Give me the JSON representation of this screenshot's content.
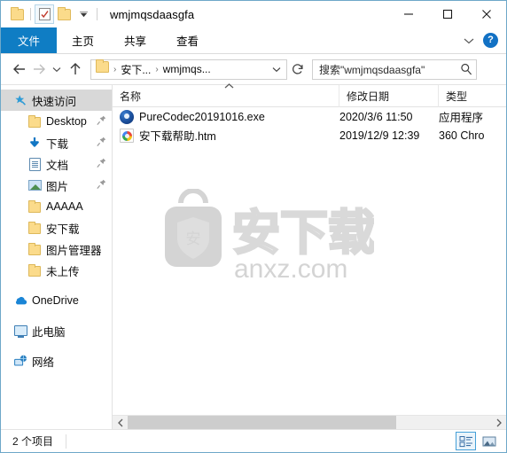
{
  "window": {
    "title": "wmjmqsdaasgfa",
    "quick_access_toolbar": [
      {
        "name": "folder-icon",
        "label": "属性"
      },
      {
        "name": "properties-icon",
        "label": "属性"
      },
      {
        "name": "new-folder-icon",
        "label": "新建文件夹"
      },
      {
        "name": "customize-dropdown-icon",
        "label": "自定义快速访问工具栏"
      }
    ],
    "caption": {
      "minimize": "—",
      "maximize": "□",
      "close": "✕"
    }
  },
  "ribbon": {
    "tabs": [
      {
        "label": "文件",
        "active": true
      },
      {
        "label": "主页",
        "active": false
      },
      {
        "label": "共享",
        "active": false
      },
      {
        "label": "查看",
        "active": false
      }
    ],
    "expand_icon": "chevron-down-icon",
    "help_label": "?"
  },
  "navigation": {
    "back_label": "←",
    "forward_label": "→",
    "recent_label": "⌄",
    "up_label": "↑",
    "breadcrumb": [
      {
        "label": "安下...",
        "sep": "›"
      },
      {
        "label": "wmjmqs...",
        "sep": ""
      }
    ],
    "dropdown_label": "⌄",
    "refresh_label": "↻"
  },
  "search": {
    "placeholder": "搜索\"wmjmqsdaasgfa\"",
    "icon": "search-icon"
  },
  "sidebar": {
    "groups": [
      {
        "items": [
          {
            "label": "快速访问",
            "icon": "star-pin-icon",
            "level": 0,
            "selected": true,
            "pinned": false
          },
          {
            "label": "Desktop",
            "icon": "folder-icon",
            "level": 1,
            "selected": false,
            "pinned": true
          },
          {
            "label": "下载",
            "icon": "download-icon",
            "level": 1,
            "selected": false,
            "pinned": true
          },
          {
            "label": "文档",
            "icon": "document-icon",
            "level": 1,
            "selected": false,
            "pinned": true
          },
          {
            "label": "图片",
            "icon": "pictures-icon",
            "level": 1,
            "selected": false,
            "pinned": true
          },
          {
            "label": "AAAAA",
            "icon": "folder-icon",
            "level": 1,
            "selected": false,
            "pinned": false
          },
          {
            "label": "安下载",
            "icon": "folder-icon",
            "level": 1,
            "selected": false,
            "pinned": false
          },
          {
            "label": "图片管理器",
            "icon": "folder-icon",
            "level": 1,
            "selected": false,
            "pinned": false
          },
          {
            "label": "未上传",
            "icon": "folder-icon",
            "level": 1,
            "selected": false,
            "pinned": false
          }
        ]
      },
      {
        "items": [
          {
            "label": "OneDrive",
            "icon": "cloud-icon",
            "level": 0,
            "selected": false,
            "pinned": false
          }
        ]
      },
      {
        "items": [
          {
            "label": "此电脑",
            "icon": "this-pc-icon",
            "level": 0,
            "selected": false,
            "pinned": false
          }
        ]
      },
      {
        "items": [
          {
            "label": "网络",
            "icon": "network-icon",
            "level": 0,
            "selected": false,
            "pinned": false
          }
        ]
      }
    ]
  },
  "filelist": {
    "columns": [
      {
        "label": "名称",
        "sorted": "asc"
      },
      {
        "label": "修改日期",
        "sorted": ""
      },
      {
        "label": "类型",
        "sorted": ""
      }
    ],
    "rows": [
      {
        "name": "PureCodec20191016.exe",
        "date": "2020/3/6 11:50",
        "type": "应用程序",
        "icon": "purecodec-icon"
      },
      {
        "name": "安下载帮助.htm",
        "date": "2019/12/9 12:39",
        "type": "360 Chro",
        "icon": "html-document-icon"
      }
    ],
    "watermark": {
      "text": "安",
      "brand": "安下载",
      "domain": "anxz.com",
      "color": "#d4d4d4"
    }
  },
  "scrollbar": {
    "left_arrow": "‹",
    "right_arrow": "›"
  },
  "statusbar": {
    "item_count": "2 个项目",
    "views": [
      {
        "name": "details-view-button",
        "label": "详细信息",
        "active": true
      },
      {
        "name": "large-icons-view-button",
        "label": "大图标",
        "active": false
      }
    ]
  },
  "colors": {
    "accent": "#0f7dc4",
    "window_border": "#6ea8c9",
    "selection": "#d8d8d8",
    "folder_yellow": "#fbdb8b"
  }
}
